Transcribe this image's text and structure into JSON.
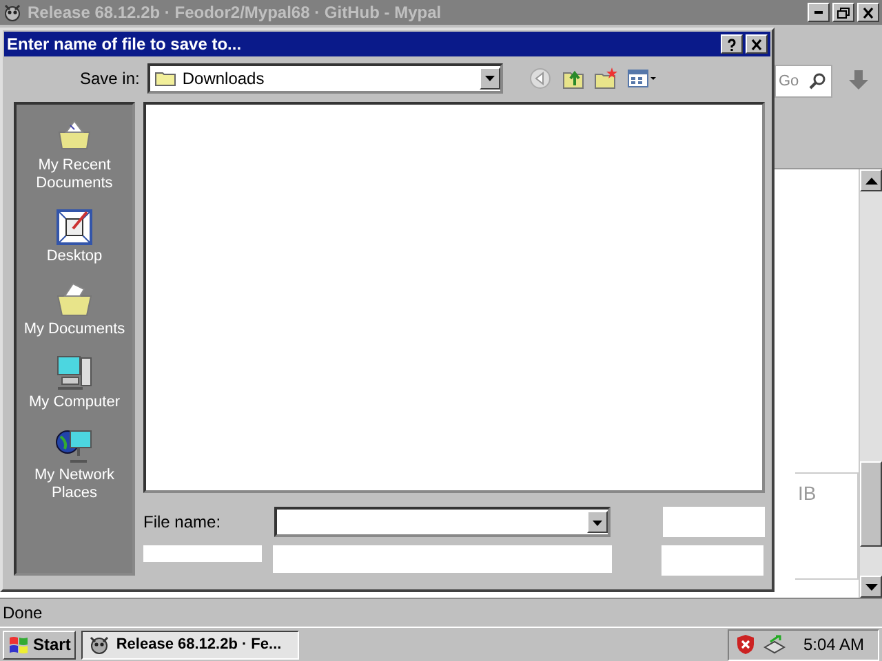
{
  "browser": {
    "title": "Release 68.12.2b · Feodor2/Mypal68 · GitHub - Mypal",
    "active": false,
    "search": {
      "placeholder": "Go"
    },
    "partial_text": "IB",
    "status": "Done"
  },
  "dialog": {
    "title": "Enter name of file to save to...",
    "active": true,
    "save_in": {
      "label": "Save in:",
      "value": "Downloads"
    },
    "places": [
      {
        "label": "My Recent Documents",
        "kind": "recent"
      },
      {
        "label": "Desktop",
        "kind": "desktop"
      },
      {
        "label": "My Documents",
        "kind": "documents"
      },
      {
        "label": "My Computer",
        "kind": "computer"
      },
      {
        "label": "My Network Places",
        "kind": "network"
      }
    ],
    "file_name": {
      "label": "File name:"
    }
  },
  "taskbar": {
    "start": "Start",
    "tasks": [
      {
        "label": "Release 68.12.2b · Fe...",
        "selected": true
      }
    ],
    "clock": "5:04 AM"
  }
}
